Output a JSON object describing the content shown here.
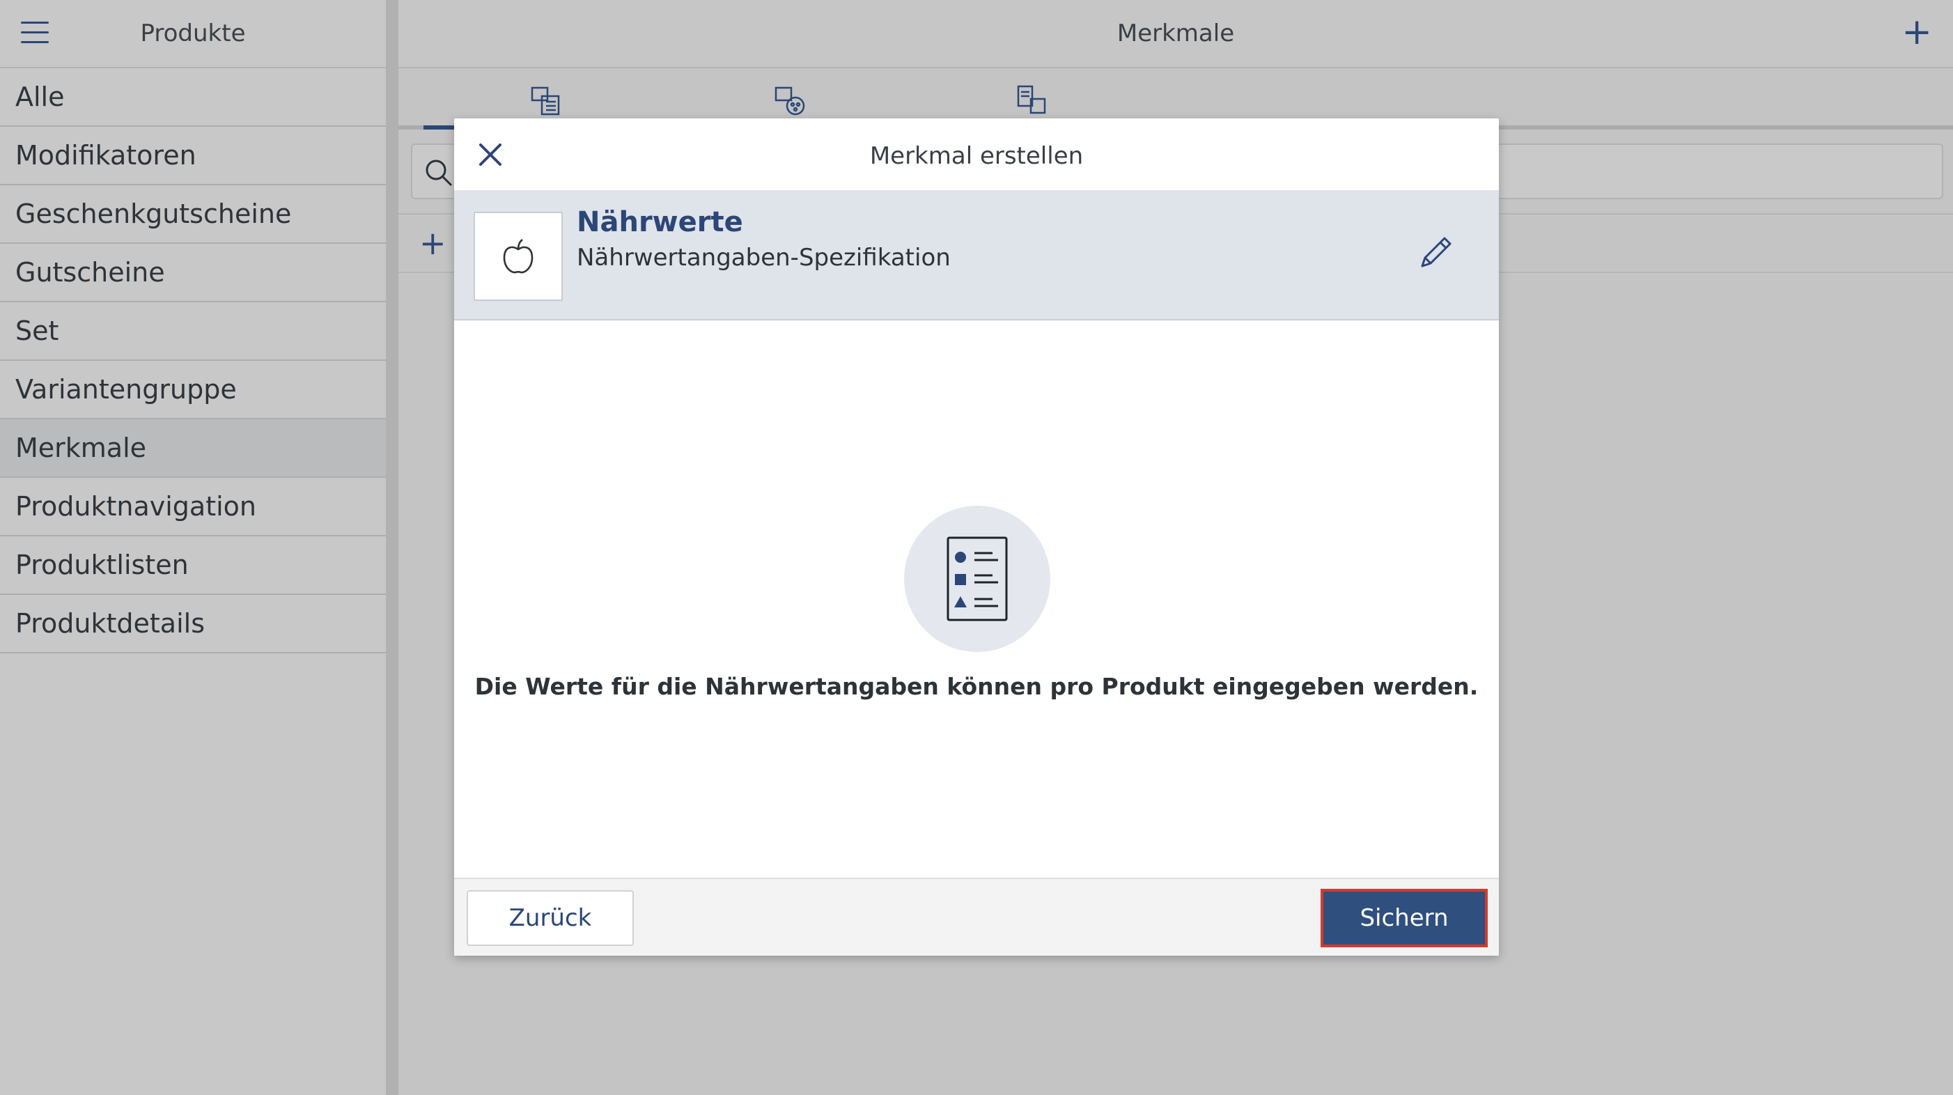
{
  "sidebar": {
    "title": "Produkte",
    "menu_icon": "hamburger-menu-icon",
    "items": [
      {
        "label": "Alle"
      },
      {
        "label": "Modifikatoren"
      },
      {
        "label": "Geschenkgutscheine"
      },
      {
        "label": "Gutscheine"
      },
      {
        "label": "Set"
      },
      {
        "label": "Variantengruppe"
      },
      {
        "label": "Merkmale",
        "active": true
      },
      {
        "label": "Produktnavigation"
      },
      {
        "label": "Produktlisten"
      },
      {
        "label": "Produktdetails"
      }
    ]
  },
  "main": {
    "title": "Merkmale",
    "add_icon": "plus-icon",
    "tabs": [
      {
        "icon": "product-list-icon",
        "active": true
      },
      {
        "icon": "product-attributes-icon"
      },
      {
        "icon": "product-details-icon"
      }
    ],
    "search_icon": "search-icon",
    "add_row_icon": "plus-icon"
  },
  "modal": {
    "title": "Merkmal erstellen",
    "close_icon": "close-icon",
    "feature": {
      "icon": "apple-icon",
      "name": "Nährwerte",
      "description": "Nährwertangaben-Spezifikation",
      "edit_icon": "pencil-icon"
    },
    "illustration_icon": "list-document-icon",
    "info_text": "Die Werte für die Nährwertangaben können pro Produkt eingegeben werden.",
    "back_label": "Zurück",
    "save_label": "Sichern"
  },
  "colors": {
    "accent": "#2b4677",
    "primary_button": "#2f4f7f",
    "highlight_border": "#d23b2b",
    "overlay_bg": "#c6c6c6"
  }
}
